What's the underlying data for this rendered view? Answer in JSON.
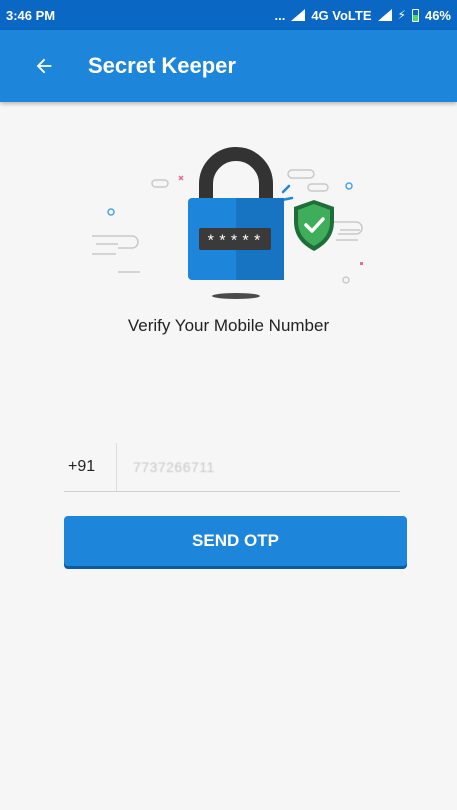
{
  "status_bar": {
    "time": "3:46 PM",
    "dots": "...",
    "network": "4G VoLTE",
    "battery_percent": "46%",
    "battery_level": 0.46,
    "icons": [
      "signal-icon",
      "charging-icon",
      "battery-icon"
    ]
  },
  "app_bar": {
    "back_icon": "arrow-left-icon",
    "title": "Secret Keeper"
  },
  "hero": {
    "pin_mask": "*****",
    "message": "Verify Your Mobile Number"
  },
  "phone": {
    "country_code": "+91",
    "value": "7737266711"
  },
  "send_otp": {
    "label": "SEND OTP"
  },
  "colors": {
    "status_bar": "#0a67c4",
    "app_bar": "#1d86db",
    "button": "#1d86db",
    "lock_body": "#1d86db",
    "shield": "#2e8b57",
    "background": "#f6f6f6"
  }
}
